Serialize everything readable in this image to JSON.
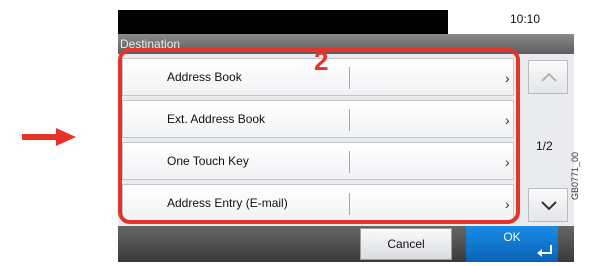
{
  "header": {
    "clock": "10:10",
    "title": "Destination"
  },
  "callout": {
    "step_number": "2",
    "accent_color": "#e6332a"
  },
  "rows": [
    {
      "label": "Address Book",
      "chevron": "›"
    },
    {
      "label": "Ext. Address Book",
      "chevron": "›"
    },
    {
      "label": "One Touch Key",
      "chevron": "›"
    },
    {
      "label": "Address Entry (E-mail)",
      "chevron": "›"
    }
  ],
  "scroll": {
    "up_icon": "chevron-up-icon",
    "down_icon": "chevron-down-icon",
    "page_indicator": "1/2"
  },
  "footer": {
    "cancel_label": "Cancel",
    "ok_label": "OK",
    "ok_color": "#0a78d6"
  },
  "figure_code": "GB0771_00"
}
